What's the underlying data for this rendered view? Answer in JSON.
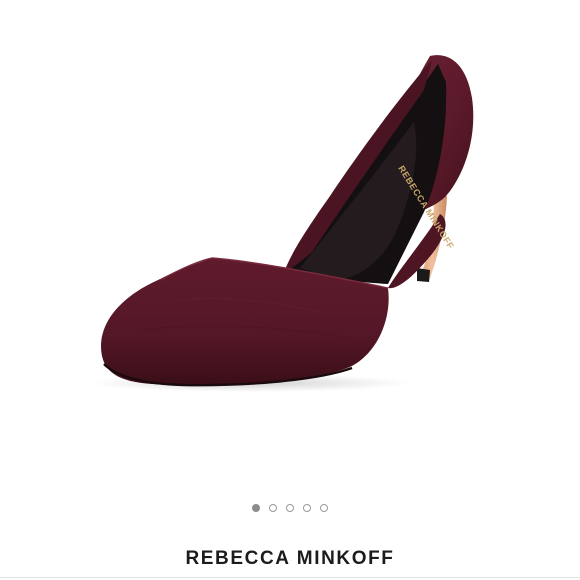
{
  "product": {
    "image_label": "Burgundy suede d'Orsay pump",
    "insole_text": "REBECCA MINKOFF",
    "brand": "REBECCA MINKOFF"
  },
  "carousel": {
    "total": 5,
    "active_index": 0
  },
  "colors": {
    "suede": "#5e1a2b",
    "heel": "#e7b08a",
    "lining": "#141012",
    "dot_active": "#8c8c8c",
    "dot_inactive": "#9a9a9a",
    "brand_text": "#1c1c1c"
  }
}
